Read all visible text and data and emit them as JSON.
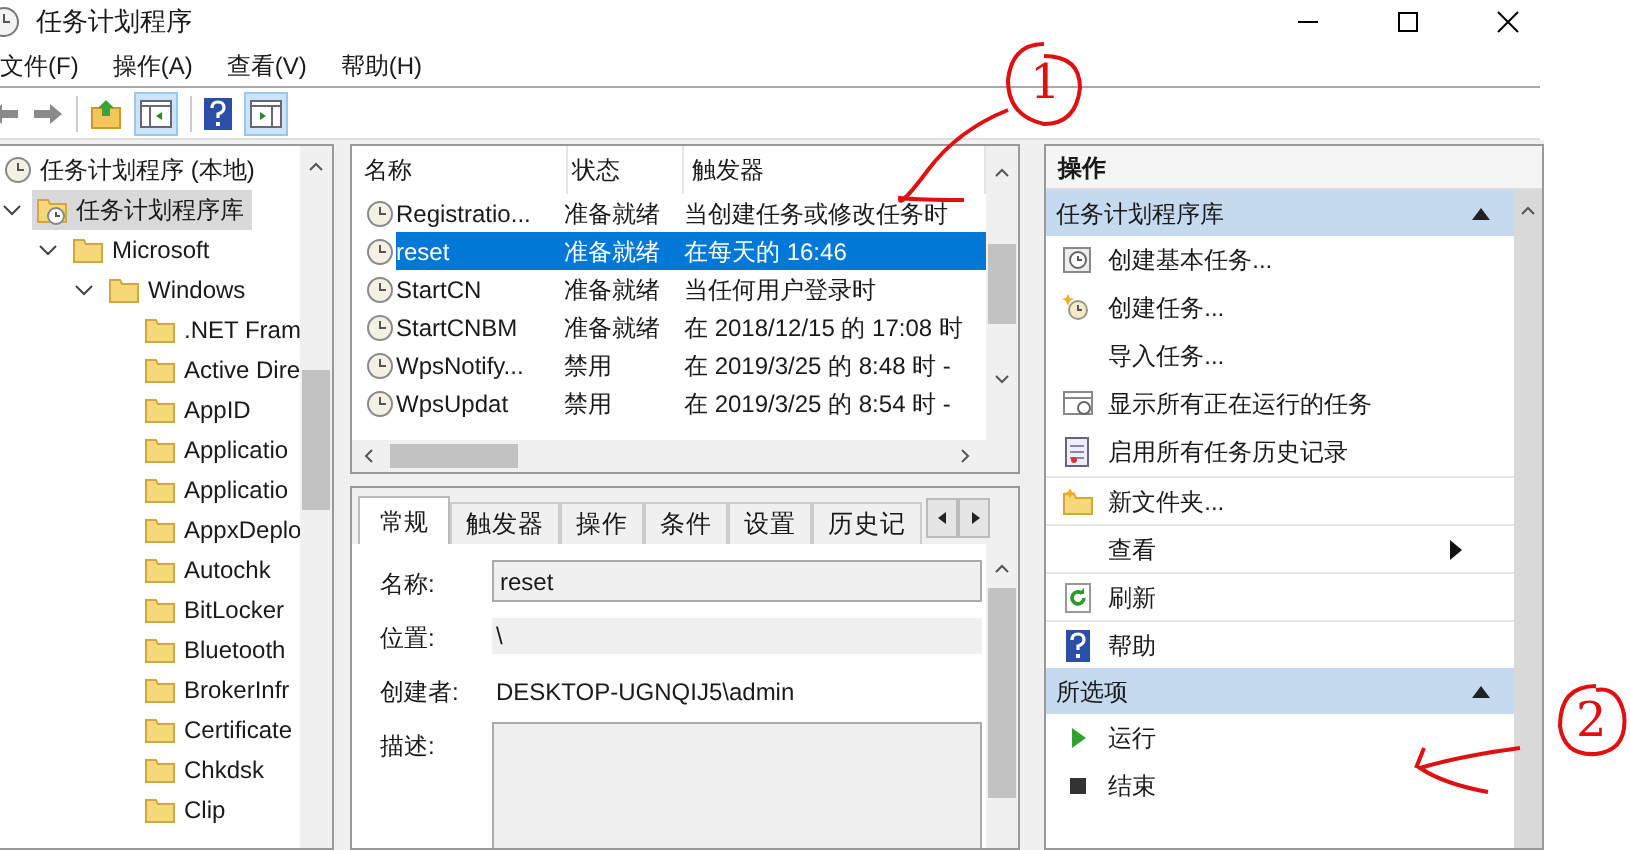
{
  "window": {
    "title": "任务计划程序"
  },
  "menu": [
    "文件(F)",
    "操作(A)",
    "查看(V)",
    "帮助(H)"
  ],
  "tree": [
    {
      "label": "任务计划程序 (本地)",
      "selected": false,
      "children": [
        {
          "label": "任务计划程序库",
          "selected": true,
          "expanded": true,
          "children": [
            {
              "label": "Microsoft",
              "selected": false,
              "expanded": true,
              "children": [
                {
                  "label": "Windows",
                  "selected": false,
                  "expanded": true,
                  "children": [
                    {
                      "label": ".NET Fram",
                      "selected": false
                    },
                    {
                      "label": "Active Dire",
                      "selected": false
                    },
                    {
                      "label": "AppID",
                      "selected": false
                    },
                    {
                      "label": "Applicatio",
                      "selected": false
                    },
                    {
                      "label": "Applicatio",
                      "selected": false
                    },
                    {
                      "label": "AppxDeplo",
                      "selected": false
                    },
                    {
                      "label": "Autochk",
                      "selected": false
                    },
                    {
                      "label": "BitLocker",
                      "selected": false
                    },
                    {
                      "label": "Bluetooth",
                      "selected": false
                    },
                    {
                      "label": "BrokerInfr",
                      "selected": false
                    },
                    {
                      "label": "Certificate",
                      "selected": false
                    },
                    {
                      "label": "Chkdsk",
                      "selected": false
                    },
                    {
                      "label": "Clip",
                      "selected": false
                    }
                  ]
                }
              ]
            }
          ]
        }
      ]
    }
  ],
  "tasks": {
    "columns": [
      "名称",
      "状态",
      "触发器"
    ],
    "rows": [
      {
        "name": "Registratio...",
        "status": "准备就绪",
        "trigger": "当创建任务或修改任务时",
        "selected": false
      },
      {
        "name": "reset",
        "status": "准备就绪",
        "trigger": "在每天的 16:46",
        "selected": true
      },
      {
        "name": "StartCN",
        "status": "准备就绪",
        "trigger": "当任何用户登录时",
        "selected": false
      },
      {
        "name": "StartCNBM",
        "status": "准备就绪",
        "trigger": "在 2018/12/15 的 17:08 时",
        "selected": false
      },
      {
        "name": "WpsNotify...",
        "status": "禁用",
        "trigger": "在 2019/3/25 的 8:48 时 -",
        "selected": false
      },
      {
        "name": "WpsUpdat",
        "status": "禁用",
        "trigger": "在 2019/3/25 的 8:54 时 -",
        "selected": false
      }
    ]
  },
  "details": {
    "tabs": [
      {
        "label": "常规",
        "selected": true
      },
      {
        "label": "触发器",
        "selected": false
      },
      {
        "label": "操作",
        "selected": false
      },
      {
        "label": "条件",
        "selected": false
      },
      {
        "label": "设置",
        "selected": false
      },
      {
        "label": "历史记",
        "selected": false
      }
    ],
    "fields": [
      {
        "label": "名称:",
        "kind": "input",
        "value": "reset"
      },
      {
        "label": "位置:",
        "kind": "readonly",
        "value": "\\"
      },
      {
        "label": "创建者:",
        "kind": "text",
        "value": "DESKTOP-UGNQIJ5\\admin"
      },
      {
        "label": "描述:",
        "kind": "textarea"
      }
    ]
  },
  "actions": {
    "title": "操作",
    "sections": [
      {
        "title": "任务计划程序库",
        "expanded": true,
        "items": [
          {
            "label": "创建基本任务...",
            "kind": "basic-task"
          },
          {
            "label": "创建任务...",
            "kind": "new-task"
          },
          {
            "label": "导入任务...",
            "kind": "plain"
          },
          {
            "label": "显示所有正在运行的任务",
            "kind": "running"
          },
          {
            "label": "启用所有任务历史记录",
            "kind": "history"
          },
          {
            "label": "新文件夹...",
            "kind": "folder"
          },
          {
            "label": "查看",
            "kind": "plain",
            "submenu": true
          },
          {
            "label": "刷新",
            "kind": "refresh"
          },
          {
            "label": "帮助",
            "kind": "help"
          }
        ]
      },
      {
        "title": "所选项",
        "expanded": true,
        "items": [
          {
            "label": "运行",
            "kind": "run"
          },
          {
            "label": "结束",
            "kind": "stop"
          }
        ]
      }
    ]
  },
  "annotations": [
    {
      "label": "1"
    },
    {
      "label": "2"
    }
  ]
}
